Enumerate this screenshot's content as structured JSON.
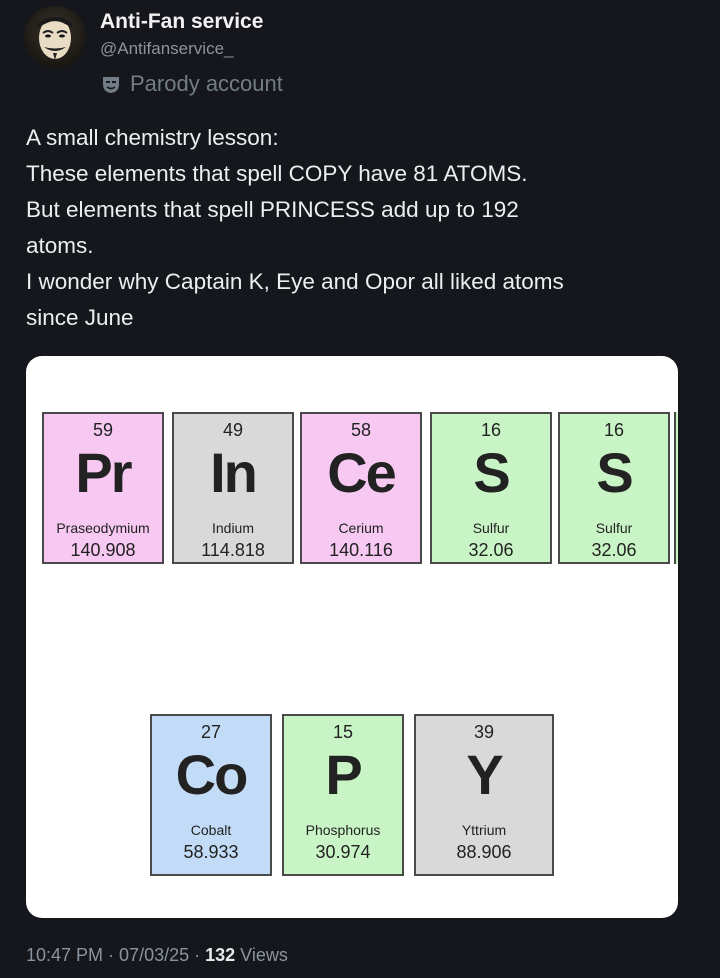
{
  "author": {
    "display_name": "Anti-Fan service",
    "handle": "@Antifanservice_",
    "parody_label": "Parody account",
    "avatar_icon": "guy-fawkes-mask-avatar",
    "parody_icon": "mask-icon"
  },
  "tweet": {
    "lines": [
      "A small chemistry lesson:",
      "These elements that spell COPY have 81 ATOMS.",
      "But elements that spell PRINCESS add up to 192",
      "atoms.",
      "I wonder why Captain K, Eye and Opor all liked atoms",
      "since June"
    ]
  },
  "media": {
    "row1": [
      {
        "number": "59",
        "symbol": "Pr",
        "name": "Praseodymium",
        "mass": "140.908",
        "color": "#f7c9f2"
      },
      {
        "number": "49",
        "symbol": "In",
        "name": "Indium",
        "mass": "114.818",
        "color": "#d9d9d9"
      },
      {
        "number": "58",
        "symbol": "Ce",
        "name": "Cerium",
        "mass": "140.116",
        "color": "#f7c9f2"
      },
      {
        "number": "16",
        "symbol": "S",
        "name": "Sulfur",
        "mass": "32.06",
        "color": "#c9f5c6"
      },
      {
        "number": "16",
        "symbol": "S",
        "name": "Sulfur",
        "mass": "32.06",
        "color": "#c9f5c6"
      }
    ],
    "row2": [
      {
        "number": "27",
        "symbol": "Co",
        "name": "Cobalt",
        "mass": "58.933",
        "color": "#c2dcf7"
      },
      {
        "number": "15",
        "symbol": "P",
        "name": "Phosphorus",
        "mass": "30.974",
        "color": "#c9f5c6"
      },
      {
        "number": "39",
        "symbol": "Y",
        "name": "Yttrium",
        "mass": "88.906",
        "color": "#d9d9d9"
      }
    ]
  },
  "meta": {
    "timestamp": "10:47 PM · 07/03/25 · ",
    "views_count": "132",
    "views_label": " Views"
  }
}
